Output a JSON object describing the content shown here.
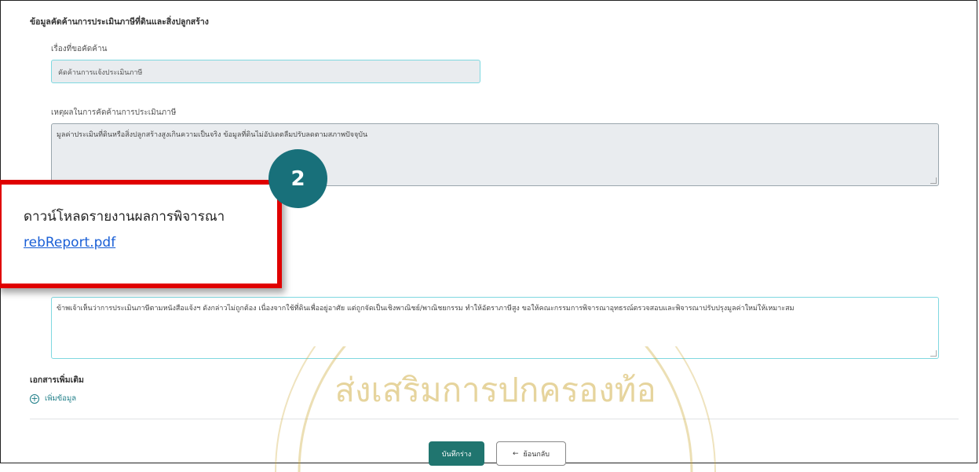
{
  "section": {
    "title": "ข้อมูลคัดค้านการประเมินภาษีที่ดินและสิ่งปลูกสร้าง"
  },
  "subject": {
    "label": "เรื่องที่ขอคัดค้าน",
    "value": "คัดค้านการแจ้งประเมินภาษี"
  },
  "reason": {
    "label": "เหตุผลในการคัดค้านการประเมินภาษี",
    "value": "มูลค่าประเมินที่ดินหรือสิ่งปลูกสร้างสูงเกินความเป็นจริง ข้อมูลที่ดินไม่อัปเดตลืมปรับลดตามสภาพปัจจุบัน"
  },
  "opinion": {
    "value": "ข้าพเจ้าเห็นว่าการประเมินภาษีตามหนังสือแจ้งฯ ดังกล่าวไม่ถูกต้อง เนื่องจากใช้ที่ดินเพื่ออยู่อาศัย แต่ถูกจัดเป็นเชิงพาณิชย์/พาณิชยกรรม ทำให้อัตราภาษีสูง ขอให้คณะกรรมการพิจารณาอุทธรณ์ตรวจสอบและพิจารณาปรับปรุงมูลค่าใหม่ให้เหมาะสม"
  },
  "extra": {
    "title": "เอกสารเพิ่มเติม",
    "add_label": "เพิ่มข้อมูล"
  },
  "buttons": {
    "save": "บันทึกร่าง",
    "back": "ย้อนกลับ"
  },
  "popup": {
    "badge": "2",
    "title": "ดาวน์โหลดรายงานผลการพิจารณา",
    "link": "rebReport.pdf"
  },
  "colors": {
    "accent": "#1b7c86",
    "highlight_border": "#e00000",
    "save_button": "#20756f",
    "watermark": "#c9a227"
  },
  "icons": {
    "add": "plus-circle-icon",
    "back": "arrow-left-icon",
    "resize": "resize-handle-icon"
  }
}
